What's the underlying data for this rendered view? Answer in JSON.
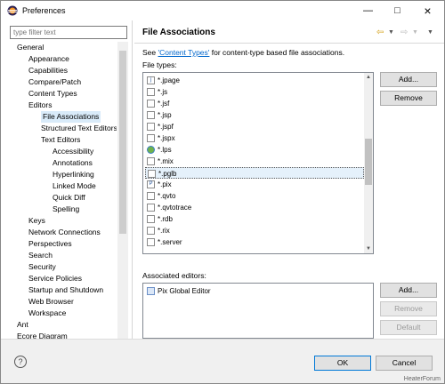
{
  "window": {
    "title": "Preferences"
  },
  "filter": {
    "placeholder": "type filter text"
  },
  "tree": [
    {
      "label": "General",
      "indent": 0
    },
    {
      "label": "Appearance",
      "indent": 1
    },
    {
      "label": "Capabilities",
      "indent": 1
    },
    {
      "label": "Compare/Patch",
      "indent": 1
    },
    {
      "label": "Content Types",
      "indent": 1
    },
    {
      "label": "Editors",
      "indent": 1
    },
    {
      "label": "File Associations",
      "indent": 2,
      "selected": true
    },
    {
      "label": "Structured Text Editors",
      "indent": 2
    },
    {
      "label": "Text Editors",
      "indent": 2
    },
    {
      "label": "Accessibility",
      "indent": 3
    },
    {
      "label": "Annotations",
      "indent": 3
    },
    {
      "label": "Hyperlinking",
      "indent": 3
    },
    {
      "label": "Linked Mode",
      "indent": 3
    },
    {
      "label": "Quick Diff",
      "indent": 3
    },
    {
      "label": "Spelling",
      "indent": 3
    },
    {
      "label": "Keys",
      "indent": 1
    },
    {
      "label": "Network Connections",
      "indent": 1
    },
    {
      "label": "Perspectives",
      "indent": 1
    },
    {
      "label": "Search",
      "indent": 1
    },
    {
      "label": "Security",
      "indent": 1
    },
    {
      "label": "Service Policies",
      "indent": 1
    },
    {
      "label": "Startup and Shutdown",
      "indent": 1
    },
    {
      "label": "Web Browser",
      "indent": 1
    },
    {
      "label": "Workspace",
      "indent": 1
    },
    {
      "label": "Ant",
      "indent": 0
    },
    {
      "label": "Ecore Diagram",
      "indent": 0
    }
  ],
  "page": {
    "title": "File Associations",
    "desc_pre": "See ",
    "desc_link": "'Content Types'",
    "desc_post": " for content-type based file associations.",
    "file_types_label": "File types:",
    "assoc_label": "Associated editors:"
  },
  "file_types": [
    {
      "name": "*.jpage",
      "icon": "j"
    },
    {
      "name": "*.js",
      "icon": ""
    },
    {
      "name": "*.jsf",
      "icon": ""
    },
    {
      "name": "*.jsp",
      "icon": ""
    },
    {
      "name": "*.jspf",
      "icon": ""
    },
    {
      "name": "*.jspx",
      "icon": ""
    },
    {
      "name": "*.lps",
      "icon": "globe"
    },
    {
      "name": "*.mix",
      "icon": ""
    },
    {
      "name": "*.pglb",
      "icon": "",
      "selected": true
    },
    {
      "name": "*.pix",
      "icon": "P"
    },
    {
      "name": "*.qvto",
      "icon": ""
    },
    {
      "name": "*.qvtotrace",
      "icon": ""
    },
    {
      "name": "*.rdb",
      "icon": ""
    },
    {
      "name": "*.rix",
      "icon": ""
    },
    {
      "name": "*.server",
      "icon": ""
    }
  ],
  "editors": [
    {
      "name": "Pix Global Editor"
    }
  ],
  "buttons": {
    "add_types": "Add...",
    "remove_types": "Remove",
    "add_editor": "Add...",
    "remove_editor": "Remove",
    "default_editor": "Default",
    "ok": "OK",
    "cancel": "Cancel"
  },
  "watermark": "HeaterForum"
}
